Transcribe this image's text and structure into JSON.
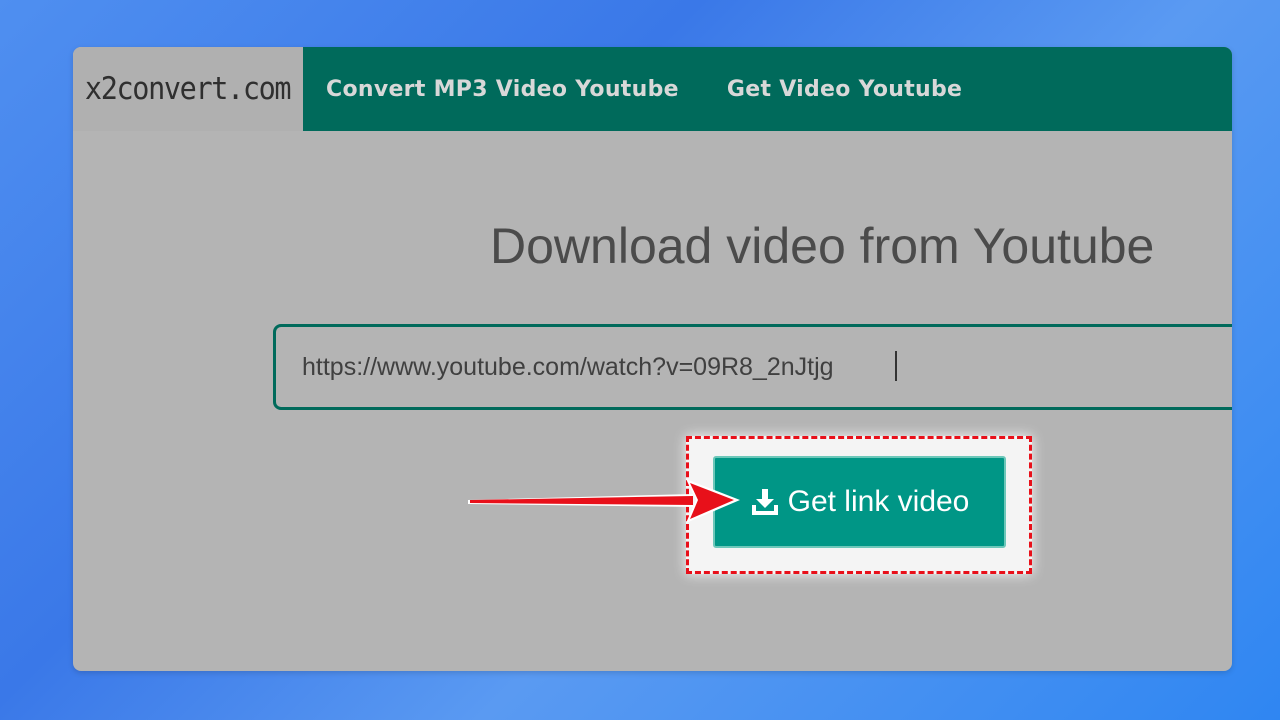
{
  "logo": "x2convert.com",
  "nav": {
    "items": [
      {
        "label": "Convert MP3 Video Youtube"
      },
      {
        "label": "Get Video Youtube"
      }
    ]
  },
  "main": {
    "title": "Download video from Youtube",
    "url_value": "https://www.youtube.com/watch?v=09R8_2nJtjg",
    "button_label": "Get link video"
  },
  "colors": {
    "nav_bg": "#006a5b",
    "button_bg": "#009686",
    "highlight_border": "#e8101a",
    "arrow": "#e8101a"
  },
  "icons": {
    "button_icon": "download-icon",
    "annotation": "red-arrow-icon"
  }
}
